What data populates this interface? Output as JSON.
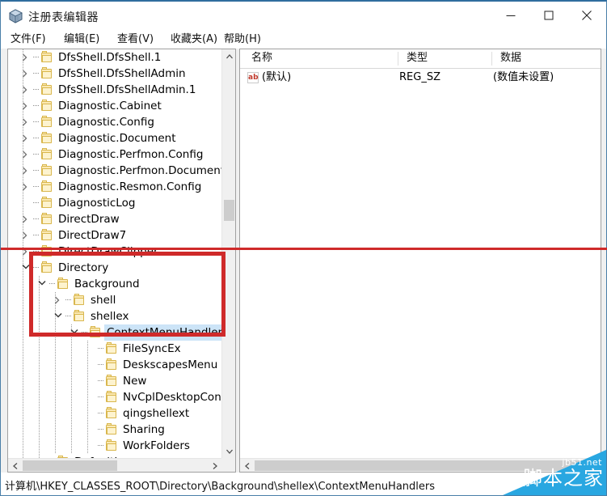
{
  "window": {
    "title": "注册表编辑器",
    "icon": "registry-editor-icon",
    "controls": {
      "minimize": "—",
      "maximize": "▢",
      "close": "✕"
    }
  },
  "menu": [
    {
      "label": "文件(F)",
      "name": "menu-file"
    },
    {
      "label": "编辑(E)",
      "name": "menu-edit"
    },
    {
      "label": "查看(V)",
      "name": "menu-view"
    },
    {
      "label": "收藏夹(A)",
      "name": "menu-favorites"
    },
    {
      "label": "帮助(H)",
      "name": "menu-help"
    }
  ],
  "tree": {
    "nodes": [
      {
        "label": "DfsShell.DfsShell.1",
        "depth": 1,
        "twist": "collapsed",
        "selected": false
      },
      {
        "label": "DfsShell.DfsShellAdmin",
        "depth": 1,
        "twist": "collapsed",
        "selected": false
      },
      {
        "label": "DfsShell.DfsShellAdmin.1",
        "depth": 1,
        "twist": "collapsed",
        "selected": false
      },
      {
        "label": "Diagnostic.Cabinet",
        "depth": 1,
        "twist": "collapsed",
        "selected": false
      },
      {
        "label": "Diagnostic.Config",
        "depth": 1,
        "twist": "collapsed",
        "selected": false
      },
      {
        "label": "Diagnostic.Document",
        "depth": 1,
        "twist": "collapsed",
        "selected": false
      },
      {
        "label": "Diagnostic.Perfmon.Config",
        "depth": 1,
        "twist": "collapsed",
        "selected": false
      },
      {
        "label": "Diagnostic.Perfmon.Document",
        "depth": 1,
        "twist": "collapsed",
        "selected": false
      },
      {
        "label": "Diagnostic.Resmon.Config",
        "depth": 1,
        "twist": "collapsed",
        "selected": false
      },
      {
        "label": "DiagnosticLog",
        "depth": 1,
        "twist": "none",
        "selected": false
      },
      {
        "label": "DirectDraw",
        "depth": 1,
        "twist": "collapsed",
        "selected": false
      },
      {
        "label": "DirectDraw7",
        "depth": 1,
        "twist": "collapsed",
        "selected": false
      },
      {
        "label": "DirectDrawClipper",
        "depth": 1,
        "twist": "collapsed",
        "selected": false
      },
      {
        "label": "Directory",
        "depth": 1,
        "twist": "expanded",
        "selected": false
      },
      {
        "label": "Background",
        "depth": 2,
        "twist": "expanded",
        "selected": false
      },
      {
        "label": "shell",
        "depth": 3,
        "twist": "collapsed",
        "selected": false
      },
      {
        "label": "shellex",
        "depth": 3,
        "twist": "expanded",
        "selected": false
      },
      {
        "label": "ContextMenuHandlers",
        "depth": 4,
        "twist": "expanded",
        "selected": true
      },
      {
        "label": "FileSyncEx",
        "depth": 5,
        "twist": "none",
        "selected": false
      },
      {
        "label": "DeskscapesMenu",
        "depth": 5,
        "twist": "none",
        "selected": false
      },
      {
        "label": "New",
        "depth": 5,
        "twist": "none",
        "selected": false
      },
      {
        "label": "NvCplDesktopCont",
        "depth": 5,
        "twist": "none",
        "selected": false
      },
      {
        "label": "qingshellext",
        "depth": 5,
        "twist": "none",
        "selected": false
      },
      {
        "label": "Sharing",
        "depth": 5,
        "twist": "none",
        "selected": false
      },
      {
        "label": "WorkFolders",
        "depth": 5,
        "twist": "none",
        "selected": false
      },
      {
        "label": "DefaultIcon",
        "depth": 2,
        "twist": "none",
        "selected": false
      }
    ],
    "selection_color": "#cce4f7"
  },
  "list": {
    "columns": [
      {
        "label": "名称",
        "name": "column-name"
      },
      {
        "label": "类型",
        "name": "column-type"
      },
      {
        "label": "数据",
        "name": "column-data"
      }
    ],
    "rows": [
      {
        "icon": "string-value-icon",
        "icon_text": "ab",
        "name": "(默认)",
        "type": "REG_SZ",
        "data": "(数值未设置)"
      }
    ]
  },
  "statusbar": {
    "path": "计算机\\HKEY_CLASSES_ROOT\\Directory\\Background\\shellex\\ContextMenuHandlers"
  },
  "annotation": {
    "color": "#cf2a2a",
    "underline_present": true,
    "box_target": "Directory / Background / shell / shellex / ContextMenuHandlers"
  },
  "watermark": {
    "line1": "jb51.net",
    "line2": "脚本之家",
    "color": "#29a7e1"
  }
}
